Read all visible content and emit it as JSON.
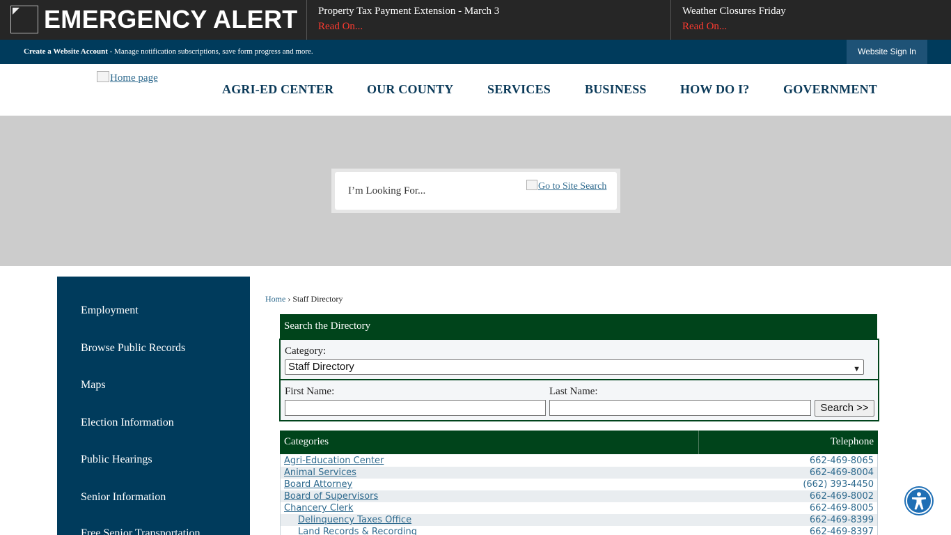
{
  "alert_bar": {
    "title": "EMERGENCY ALERT",
    "items": [
      {
        "title": "Property Tax Payment Extension - March 3",
        "link": "Read On..."
      },
      {
        "title": "Weather Closures Friday",
        "link": "Read On..."
      }
    ]
  },
  "account_bar": {
    "create_account": "Create a Website Account",
    "description": " - Manage notification subscriptions, save form progress and more.",
    "sign_in": "Website Sign In"
  },
  "header": {
    "logo_alt": "Home page",
    "nav": [
      "AGRI-ED CENTER",
      "OUR COUNTY",
      "SERVICES",
      "BUSINESS",
      "HOW DO I?",
      "GOVERNMENT"
    ]
  },
  "hero": {
    "search_placeholder": "I’m Looking For...",
    "site_search_alt": "Go to Site Search"
  },
  "sidebar": {
    "items": [
      "Employment",
      "Browse Public Records",
      "Maps",
      "Election Information",
      "Public Hearings",
      "Senior Information",
      "Free Senior Transportation"
    ]
  },
  "breadcrumb": {
    "home": "Home",
    "separator": " › ",
    "current": "Staff Directory"
  },
  "directory_search": {
    "heading": "Search the Directory",
    "category_label": "Category:",
    "category_value": "Staff Directory",
    "first_name_label": "First Name:",
    "last_name_label": "Last Name:",
    "search_button": "Search >>"
  },
  "table": {
    "col_categories": "Categories",
    "col_telephone": "Telephone",
    "rows": [
      {
        "name": "Agri-Education Center",
        "phone": "662-469-8065",
        "indent": false
      },
      {
        "name": "Animal Services",
        "phone": "662-469-8004",
        "indent": false
      },
      {
        "name": "Board Attorney",
        "phone": "(662) 393-4450",
        "indent": false
      },
      {
        "name": "Board of Supervisors",
        "phone": "662-469-8002",
        "indent": false
      },
      {
        "name": "Chancery Clerk",
        "phone": "662-469-8005",
        "indent": false
      },
      {
        "name": "Delinquency Taxes Office",
        "phone": "662-469-8399",
        "indent": true
      },
      {
        "name": "Land Records & Recording",
        "phone": "662-469-8397",
        "indent": true
      }
    ]
  },
  "colors": {
    "alert_bg": "#262626",
    "alert_link": "#ff3b30",
    "navy": "#003b5c",
    "forest_green": "#00441b",
    "link_blue": "#2e6a8e",
    "a11y_blue": "#1f6fb5"
  },
  "icons": {
    "alert": "broken-image-icon",
    "accessibility": "accessibility-icon"
  }
}
